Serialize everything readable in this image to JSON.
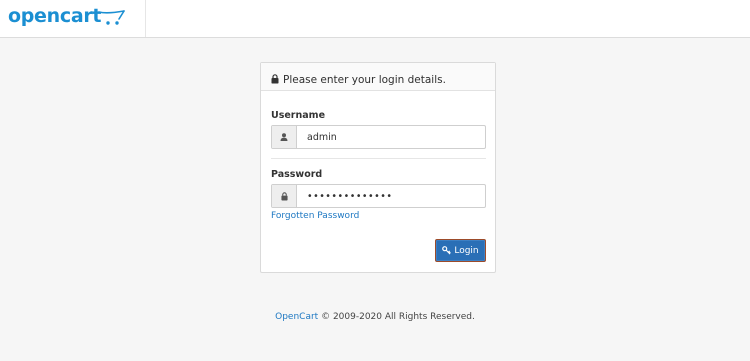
{
  "header": {
    "logo_text": "opencart",
    "logo_icon": "cart-icon",
    "brand_color": "#1b8fd2"
  },
  "login_panel": {
    "heading": "Please enter your login details.",
    "heading_icon": "lock-icon",
    "username": {
      "label": "Username",
      "value": "admin",
      "icon": "user-icon"
    },
    "password": {
      "label": "Password",
      "value": "••••••••••••••",
      "icon": "lock-icon"
    },
    "forgot_link": "Forgotten Password",
    "login_button": {
      "label": "Login",
      "icon": "key-icon",
      "color": "#2a6fb6"
    }
  },
  "footer": {
    "link": "OpenCart",
    "text": "© 2009-2020 All Rights Reserved."
  }
}
